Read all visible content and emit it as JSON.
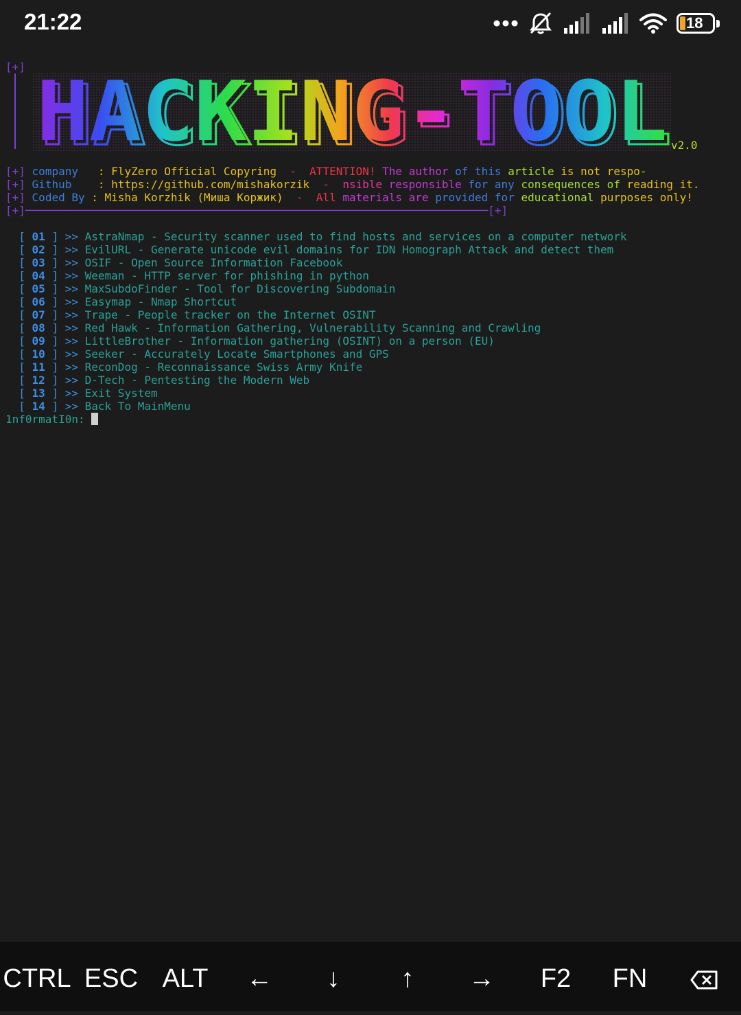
{
  "status_bar": {
    "time": "21:22",
    "icons": [
      "more-dots-icon",
      "bell-muted-icon",
      "signal-1-icon",
      "signal-2-icon",
      "wifi-icon",
      "battery-icon"
    ],
    "battery_level": "18"
  },
  "banner": {
    "bracket": "[+]",
    "art_text": "HACKING-TOOL",
    "version": "v2.0"
  },
  "info": {
    "l1_prefix": "[+]",
    "l1_label": "company",
    "l1_sep": ":",
    "l1_value": "FlyZero Official Copyring",
    "l1_dash": "-",
    "l1_w1": "ATTENTION!",
    "l1_w2": "The",
    "l1_w3": "author",
    "l1_w4": "of",
    "l1_w5": "this",
    "l1_w6": "article",
    "l1_w7": "is not respo-",
    "l2_prefix": "[+]",
    "l2_label": "Github",
    "l2_sep": ":",
    "l2_value": "https://github.com/mishakorzik",
    "l2_dash": "-",
    "l2_w1": "nsible",
    "l2_w2": "responsible",
    "l2_w3": "for",
    "l2_w4": "any",
    "l2_w5": "consequences of",
    "l2_w6": "reading it.",
    "l3_prefix": "[+]",
    "l3_label": "Coded By",
    "l3_sep": ":",
    "l3_value": "Misha Korzhik (Миша Коржик)",
    "l3_dash": "-",
    "l3_w1": "All",
    "l3_w2": "materials are",
    "l3_w3": "provided",
    "l3_w4": "for",
    "l3_w5": "educational",
    "l3_w6": "purposes only!",
    "divider_start": "[+]",
    "divider_line": "──────────────────────────────────────────────────────────────────────",
    "divider_end": "[+]"
  },
  "menu": [
    {
      "idx": "01",
      "text": "AstraNmap - Security scanner used to find hosts and services on a computer network"
    },
    {
      "idx": "02",
      "text": "EvilURL - Generate unicode evil domains for IDN Homograph Attack and detect them"
    },
    {
      "idx": "03",
      "text": "OSIF - Open Source Information Facebook"
    },
    {
      "idx": "04",
      "text": "Weeman - HTTP server for phishing in python"
    },
    {
      "idx": "05",
      "text": "MaxSubdoFinder - Tool for Discovering Subdomain"
    },
    {
      "idx": "06",
      "text": "Easymap - Nmap Shortcut"
    },
    {
      "idx": "07",
      "text": "Trape - People tracker on the Internet OSINT"
    },
    {
      "idx": "08",
      "text": "Red Hawk - Information Gathering, Vulnerability Scanning and Crawling"
    },
    {
      "idx": "09",
      "text": "LittleBrother - Information gathering (OSINT) on a person (EU)"
    },
    {
      "idx": "10",
      "text": "Seeker - Accurately Locate Smartphones and GPS"
    },
    {
      "idx": "11",
      "text": "ReconDog - Reconnaissance Swiss Army Knife"
    },
    {
      "idx": "12",
      "text": "D-Tech - Pentesting the Modern Web"
    },
    {
      "idx": "13",
      "text": "Exit System"
    },
    {
      "idx": "14",
      "text": "Back To MainMenu"
    }
  ],
  "menu_syntax": {
    "open": "[",
    "close": "]",
    "arrow": ">>"
  },
  "prompt": "1nf0rmatI0n:",
  "extra_keys": [
    "CTRL",
    "ESC",
    "ALT",
    "←",
    "↓",
    "↑",
    "→",
    "F2",
    "FN"
  ],
  "extra_keys_icons": [
    "backspace-icon"
  ]
}
